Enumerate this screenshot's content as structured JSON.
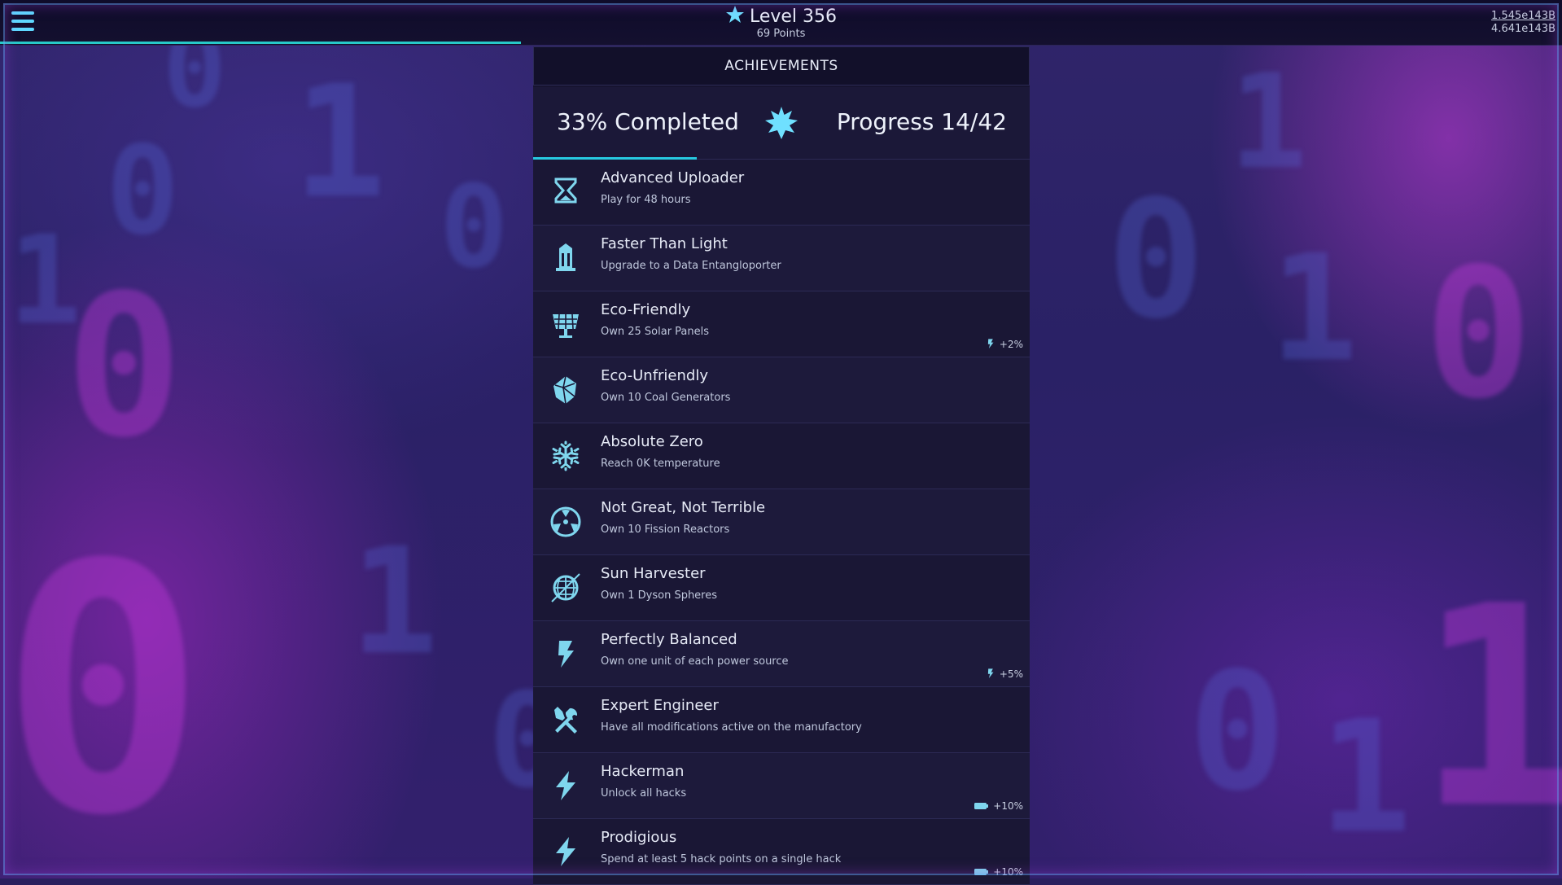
{
  "header": {
    "level_label": "Level 356",
    "points_label": "69 Points",
    "resource_1": "1.545e143B",
    "resource_2": "4.641e143B"
  },
  "panel": {
    "title": "ACHIEVEMENTS",
    "completed_label": "33% Completed",
    "progress_label": "Progress 14/42",
    "completed_fraction": 0.33
  },
  "colors": {
    "accent": "#27c9e0",
    "icon": "#7fd6ee"
  },
  "achievements": [
    {
      "title": "Advanced Uploader",
      "desc": "Play for 48 hours",
      "icon": "hourglass-icon",
      "bonus": ""
    },
    {
      "title": "Faster Than Light",
      "desc": "Upgrade to a Data Entangloporter",
      "icon": "tower-icon",
      "bonus": ""
    },
    {
      "title": "Eco-Friendly",
      "desc": "Own 25 Solar Panels",
      "icon": "solar-panel-icon",
      "bonus": "+2%",
      "bonus_icon": "lightning-icon"
    },
    {
      "title": "Eco-Unfriendly",
      "desc": "Own 10 Coal Generators",
      "icon": "coal-icon",
      "bonus": ""
    },
    {
      "title": "Absolute Zero",
      "desc": "Reach 0K temperature",
      "icon": "snowflake-icon",
      "bonus": ""
    },
    {
      "title": "Not Great, Not Terrible",
      "desc": "Own 10 Fission Reactors",
      "icon": "radiation-icon",
      "bonus": ""
    },
    {
      "title": "Sun Harvester",
      "desc": "Own 1 Dyson Spheres",
      "icon": "sphere-icon",
      "bonus": ""
    },
    {
      "title": "Perfectly Balanced",
      "desc": "Own one unit of each power source",
      "icon": "lightning-icon",
      "bonus": "+5%",
      "bonus_icon": "lightning-icon"
    },
    {
      "title": "Expert Engineer",
      "desc": "Have all modifications active on the manufactory",
      "icon": "tools-icon",
      "bonus": ""
    },
    {
      "title": "Hackerman",
      "desc": "Unlock all hacks",
      "icon": "bolt-icon",
      "bonus": "+10%",
      "bonus_icon": "battery-icon"
    },
    {
      "title": "Prodigious",
      "desc": "Spend at least 5 hack points on a single hack",
      "icon": "bolt-icon",
      "bonus": "+10%",
      "bonus_icon": "battery-icon"
    }
  ]
}
